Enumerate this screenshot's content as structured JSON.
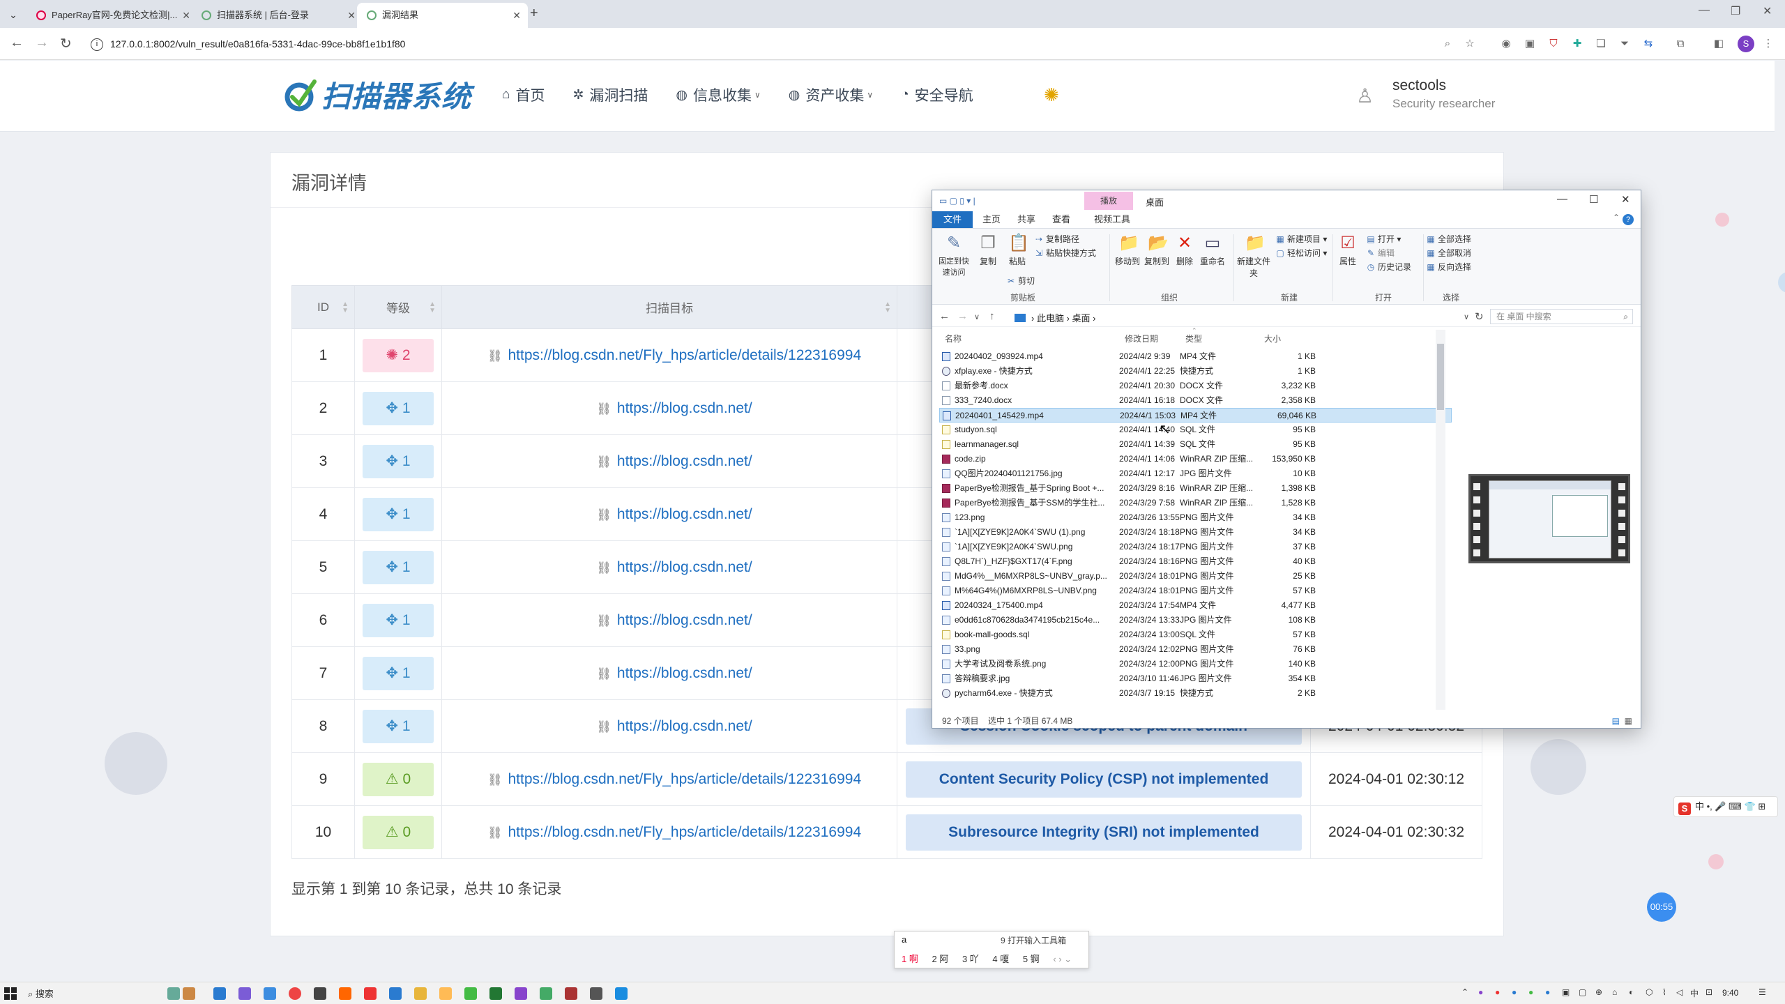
{
  "browser": {
    "tabs": [
      {
        "title": "PaperRay官网-免费论文检测|..."
      },
      {
        "title": "扫描器系统 | 后台-登录"
      },
      {
        "title": "漏洞结果"
      }
    ],
    "url": "127.0.0.1:8002/vuln_result/e0a816fa-5331-4dac-99ce-bb8f1e1b1f80",
    "profile_initial": "S"
  },
  "site": {
    "logo_text": "扫描器系统",
    "nav": [
      {
        "label": "首页",
        "icon": "home-icon",
        "dropdown": false
      },
      {
        "label": "漏洞扫描",
        "icon": "bug-icon",
        "dropdown": false
      },
      {
        "label": "信息收集",
        "icon": "globe-icon",
        "dropdown": true
      },
      {
        "label": "资产收集",
        "icon": "globe-icon",
        "dropdown": true
      },
      {
        "label": "安全导航",
        "icon": "edge-icon",
        "dropdown": false
      }
    ],
    "user": {
      "name": "sectools",
      "role": "Security researcher"
    }
  },
  "card": {
    "title": "漏洞详情",
    "columns": [
      "ID",
      "等级",
      "扫描目标"
    ],
    "rows": [
      {
        "id": "1",
        "level": "2",
        "severity": "high",
        "target": "https://blog.csdn.net/Fly_hps/article/details/122316994",
        "name": "",
        "time": ""
      },
      {
        "id": "2",
        "level": "1",
        "severity": "low",
        "target": "https://blog.csdn.net/",
        "name": "",
        "time": ""
      },
      {
        "id": "3",
        "level": "1",
        "severity": "low",
        "target": "https://blog.csdn.net/",
        "name": "",
        "time": ""
      },
      {
        "id": "4",
        "level": "1",
        "severity": "low",
        "target": "https://blog.csdn.net/",
        "name": "",
        "time": ""
      },
      {
        "id": "5",
        "level": "1",
        "severity": "low",
        "target": "https://blog.csdn.net/",
        "name": "",
        "time": ""
      },
      {
        "id": "6",
        "level": "1",
        "severity": "low",
        "target": "https://blog.csdn.net/",
        "name": "",
        "time": ""
      },
      {
        "id": "7",
        "level": "1",
        "severity": "low",
        "target": "https://blog.csdn.net/",
        "name": "",
        "time": ""
      },
      {
        "id": "8",
        "level": "1",
        "severity": "low",
        "target": "https://blog.csdn.net/",
        "name": "Session Cookie scoped to parent domain",
        "time": "2024-04-01 02:30:32"
      },
      {
        "id": "9",
        "level": "0",
        "severity": "info",
        "target": "https://blog.csdn.net/Fly_hps/article/details/122316994",
        "name": "Content Security Policy (CSP) not implemented",
        "time": "2024-04-01 02:30:12"
      },
      {
        "id": "10",
        "level": "0",
        "severity": "info",
        "target": "https://blog.csdn.net/Fly_hps/article/details/122316994",
        "name": "Subresource Integrity (SRI) not implemented",
        "time": "2024-04-01 02:30:32"
      }
    ],
    "footer": "显示第 1 到第 10 条记录，总共 10 条记录"
  },
  "explorer": {
    "play_tab": "播放",
    "title": "桌面",
    "tabs": [
      "文件",
      "主页",
      "共享",
      "查看",
      "视频工具"
    ],
    "ribbon": {
      "pin": "固定到快速访问",
      "copy": "复制",
      "paste": "粘贴",
      "copy_path": "复制路径",
      "paste_shortcut": "粘贴快捷方式",
      "cut": "剪切",
      "move_to": "移动到",
      "copy_to": "复制到",
      "delete": "删除",
      "rename": "重命名",
      "new_folder": "新建文件夹",
      "new_item": "新建项目",
      "easy_access": "轻松访问",
      "properties": "属性",
      "open": "打开",
      "edit": "编辑",
      "history": "历史记录",
      "select_all": "全部选择",
      "select_none": "全部取消",
      "invert": "反向选择",
      "groups": [
        "剪贴板",
        "组织",
        "新建",
        "打开",
        "选择"
      ]
    },
    "breadcrumb": [
      "此电脑",
      "桌面"
    ],
    "search_placeholder": "在 桌面 中搜索",
    "columns": [
      "名称",
      "修改日期",
      "类型",
      "大小"
    ],
    "files": [
      {
        "name": "20240402_093924.mp4",
        "date": "2024/4/2 9:39",
        "type": "MP4 文件",
        "size": "1 KB",
        "kind": "doc"
      },
      {
        "name": "xfplay.exe - 快捷方式",
        "date": "2024/4/1 22:25",
        "type": "快捷方式",
        "size": "1 KB",
        "kind": "lnk"
      },
      {
        "name": "最新参考.docx",
        "date": "2024/4/1 20:30",
        "type": "DOCX 文件",
        "size": "3,232 KB",
        "kind": "generic"
      },
      {
        "name": "333_7240.docx",
        "date": "2024/4/1 16:18",
        "type": "DOCX 文件",
        "size": "2,358 KB",
        "kind": "generic"
      },
      {
        "name": "20240401_145429.mp4",
        "date": "2024/4/1 15:03",
        "type": "MP4 文件",
        "size": "69,046 KB",
        "kind": "doc",
        "selected": true
      },
      {
        "name": "studyon.sql",
        "date": "2024/4/1 14:40",
        "type": "SQL 文件",
        "size": "95 KB",
        "kind": "sql"
      },
      {
        "name": "learnmanager.sql",
        "date": "2024/4/1 14:39",
        "type": "SQL 文件",
        "size": "95 KB",
        "kind": "sql"
      },
      {
        "name": "code.zip",
        "date": "2024/4/1 14:06",
        "type": "WinRAR ZIP 压缩...",
        "size": "153,950 KB",
        "kind": "zip"
      },
      {
        "name": "QQ图片20240401121756.jpg",
        "date": "2024/4/1 12:17",
        "type": "JPG 图片文件",
        "size": "10 KB",
        "kind": "img"
      },
      {
        "name": "PaperBye检测报告_基于Spring Boot +...",
        "date": "2024/3/29 8:16",
        "type": "WinRAR ZIP 压缩...",
        "size": "1,398 KB",
        "kind": "zip"
      },
      {
        "name": "PaperBye检测报告_基于SSM的学生社...",
        "date": "2024/3/29 7:58",
        "type": "WinRAR ZIP 压缩...",
        "size": "1,528 KB",
        "kind": "zip"
      },
      {
        "name": "123.png",
        "date": "2024/3/26 13:55",
        "type": "PNG 图片文件",
        "size": "34 KB",
        "kind": "img"
      },
      {
        "name": "`1A][X[ZYE9K]2A0K4`SWU (1).png",
        "date": "2024/3/24 18:18",
        "type": "PNG 图片文件",
        "size": "34 KB",
        "kind": "img"
      },
      {
        "name": "`1A][X[ZYE9K]2A0K4`SWU.png",
        "date": "2024/3/24 18:17",
        "type": "PNG 图片文件",
        "size": "37 KB",
        "kind": "img"
      },
      {
        "name": "Q8L7H`)_HZF}$GXT17(4`F.png",
        "date": "2024/3/24 18:16",
        "type": "PNG 图片文件",
        "size": "40 KB",
        "kind": "img"
      },
      {
        "name": "MdG4%__M6MXRP8LS~UNBV_gray.p...",
        "date": "2024/3/24 18:01",
        "type": "PNG 图片文件",
        "size": "25 KB",
        "kind": "img"
      },
      {
        "name": "M%64G4%()M6MXRP8LS~UNBV.png",
        "date": "2024/3/24 18:01",
        "type": "PNG 图片文件",
        "size": "57 KB",
        "kind": "img"
      },
      {
        "name": "20240324_175400.mp4",
        "date": "2024/3/24 17:54",
        "type": "MP4 文件",
        "size": "4,477 KB",
        "kind": "doc"
      },
      {
        "name": "e0dd61c870628da3474195cb215c4e...",
        "date": "2024/3/24 13:33",
        "type": "JPG 图片文件",
        "size": "108 KB",
        "kind": "img"
      },
      {
        "name": "book-mall-goods.sql",
        "date": "2024/3/24 13:00",
        "type": "SQL 文件",
        "size": "57 KB",
        "kind": "sql"
      },
      {
        "name": "33.png",
        "date": "2024/3/24 12:02",
        "type": "PNG 图片文件",
        "size": "76 KB",
        "kind": "img"
      },
      {
        "name": "大学考试及阅卷系统.png",
        "date": "2024/3/24 12:00",
        "type": "PNG 图片文件",
        "size": "140 KB",
        "kind": "img"
      },
      {
        "name": "答辩稿要求.jpg",
        "date": "2024/3/10 11:46",
        "type": "JPG 图片文件",
        "size": "354 KB",
        "kind": "img"
      },
      {
        "name": "pycharm64.exe - 快捷方式",
        "date": "2024/3/7 19:15",
        "type": "快捷方式",
        "size": "2 KB",
        "kind": "lnk"
      }
    ],
    "status_count": "92 个项目",
    "status_selected": "选中 1 个项目  67.4 MB"
  },
  "ime": {
    "input": "a",
    "hint": "9 打开输入工具箱",
    "candidates": [
      "1 啊",
      "2 阿",
      "3 吖",
      "4 嗄",
      "5 锕"
    ]
  },
  "ime_bar": {
    "text": "中 •, 🎤 ⌨ 👕 ⊞"
  },
  "timer": "00:55",
  "taskbar": {
    "search": "搜索",
    "time": "9:40"
  },
  "colors": {
    "accent": "#1f6fc1",
    "high": "#e0456e",
    "low": "#3d8ec9",
    "info": "#5a9c23"
  }
}
